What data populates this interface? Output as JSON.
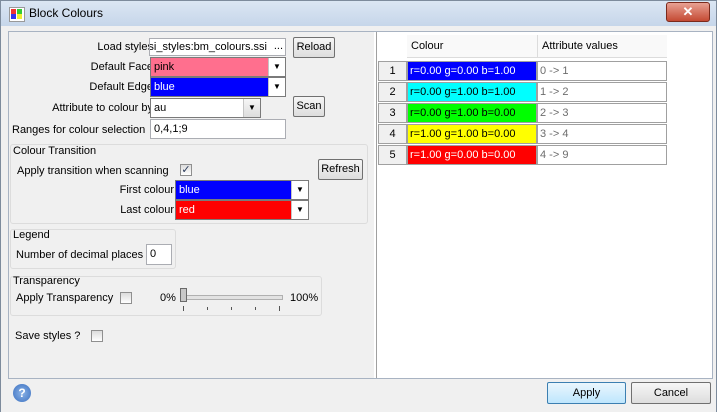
{
  "window": {
    "title": "Block Colours",
    "close_label": "✕"
  },
  "form": {
    "load_styles_label": "Load styles",
    "load_styles_value": "si_styles:bm_colours.ssi",
    "load_browse": "...",
    "reload_label": "Reload",
    "default_face_label": "Default Face",
    "default_face_value": "pink",
    "default_edge_label": "Default Edge",
    "default_edge_value": "blue",
    "attribute_label": "Attribute to colour by",
    "attribute_value": "au",
    "scan_label": "Scan",
    "ranges_label": "Ranges for colour selection",
    "ranges_value": "0,4,1;9"
  },
  "transition": {
    "title": "Colour Transition",
    "apply_label": "Apply transition when scanning",
    "apply_checked": "✓",
    "refresh_label": "Refresh",
    "first_label": "First colour",
    "first_value": "blue",
    "last_label": "Last colour",
    "last_value": "red"
  },
  "legend": {
    "title": "Legend",
    "decimals_label": "Number of decimal places",
    "decimals_value": "0"
  },
  "transparency": {
    "title": "Transparency",
    "apply_label": "Apply Transparency",
    "min_label": "0%",
    "max_label": "100%",
    "level": 0
  },
  "save_styles_label": "Save styles ?",
  "table": {
    "headers": [
      "Colour",
      "Attribute values"
    ],
    "rows": [
      {
        "num": "1",
        "colour": "r=0.00 g=0.00 b=1.00",
        "bg": "#0000ff",
        "fg": "#ffffff",
        "attr": "0 -> 1"
      },
      {
        "num": "2",
        "colour": "r=0.00 g=1.00 b=1.00",
        "bg": "#00ffff",
        "fg": "#000000",
        "attr": "1 -> 2"
      },
      {
        "num": "3",
        "colour": "r=0.00 g=1.00 b=0.00",
        "bg": "#00ff00",
        "fg": "#000000",
        "attr": "2 -> 3"
      },
      {
        "num": "4",
        "colour": "r=1.00 g=1.00 b=0.00",
        "bg": "#ffff00",
        "fg": "#000000",
        "attr": "3 -> 4"
      },
      {
        "num": "5",
        "colour": "r=1.00 g=0.00 b=0.00",
        "bg": "#ff0000",
        "fg": "#ffffff",
        "attr": "4 -> 9"
      }
    ]
  },
  "footer": {
    "help": "?",
    "apply_label": "Apply",
    "cancel_label": "Cancel"
  },
  "colors": {
    "pink": "#ff6f8e",
    "blue": "#0000ff",
    "red": "#ff0000"
  }
}
